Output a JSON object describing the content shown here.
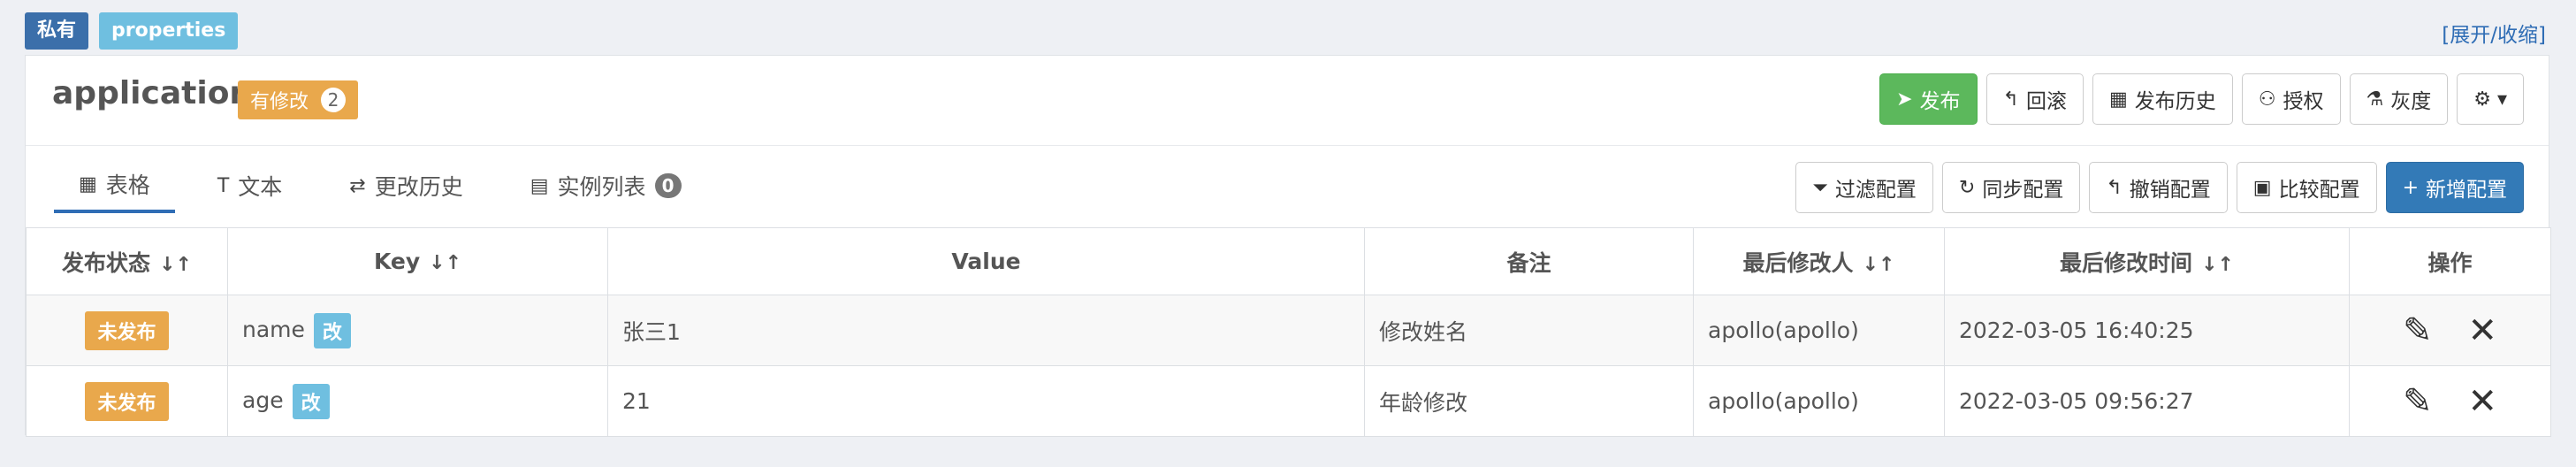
{
  "top": {
    "private_tag": "私有",
    "format_tag": "properties",
    "toggle_link": "[展开/收缩]"
  },
  "namespace": {
    "title": "application",
    "modified_label": "有修改",
    "modified_count": "2"
  },
  "head_actions": [
    {
      "label": "发布",
      "icon": "send-icon",
      "glyph": "➤"
    },
    {
      "label": "回滚",
      "icon": "rollback-icon",
      "glyph": "↰"
    },
    {
      "label": "发布历史",
      "icon": "calendar-icon",
      "glyph": "▦"
    },
    {
      "label": "授权",
      "icon": "user-icon",
      "glyph": "⚇"
    },
    {
      "label": "灰度",
      "icon": "flask-icon",
      "glyph": "⚗"
    }
  ],
  "settings_glyph": "⚙ ▾",
  "tabs": [
    {
      "label": "表格",
      "glyph": "▦"
    },
    {
      "label": "文本",
      "glyph": "T"
    },
    {
      "label": "更改历史",
      "glyph": "⇄"
    },
    {
      "label": "实例列表",
      "glyph": "▤",
      "badge": "0"
    }
  ],
  "tab_actions": [
    {
      "label": "过滤配置",
      "icon": "filter-icon",
      "glyph": "⏷"
    },
    {
      "label": "同步配置",
      "icon": "sync-icon",
      "glyph": "↻"
    },
    {
      "label": "撤销配置",
      "icon": "undo-icon",
      "glyph": "↰"
    },
    {
      "label": "比较配置",
      "icon": "compare-icon",
      "glyph": "▣"
    },
    {
      "label": "新增配置",
      "icon": "plus-icon",
      "glyph": "+"
    }
  ],
  "table": {
    "headers": [
      "发布状态",
      "Key",
      "Value",
      "备注",
      "最后修改人",
      "最后修改时间",
      "操作"
    ],
    "sort_glyph": "↓↑",
    "rows": [
      {
        "status": "未发布",
        "key": "name",
        "key_tag": "改",
        "value": "张三1",
        "comment": "修改姓名",
        "modifier": "apollo(apollo)",
        "time": "2022-03-05 16:40:25"
      },
      {
        "status": "未发布",
        "key": "age",
        "key_tag": "改",
        "value": "21",
        "comment": "年龄修改",
        "modifier": "apollo(apollo)",
        "time": "2022-03-05 09:56:27"
      }
    ],
    "edit_glyph": "✎",
    "delete_glyph": "✕"
  }
}
